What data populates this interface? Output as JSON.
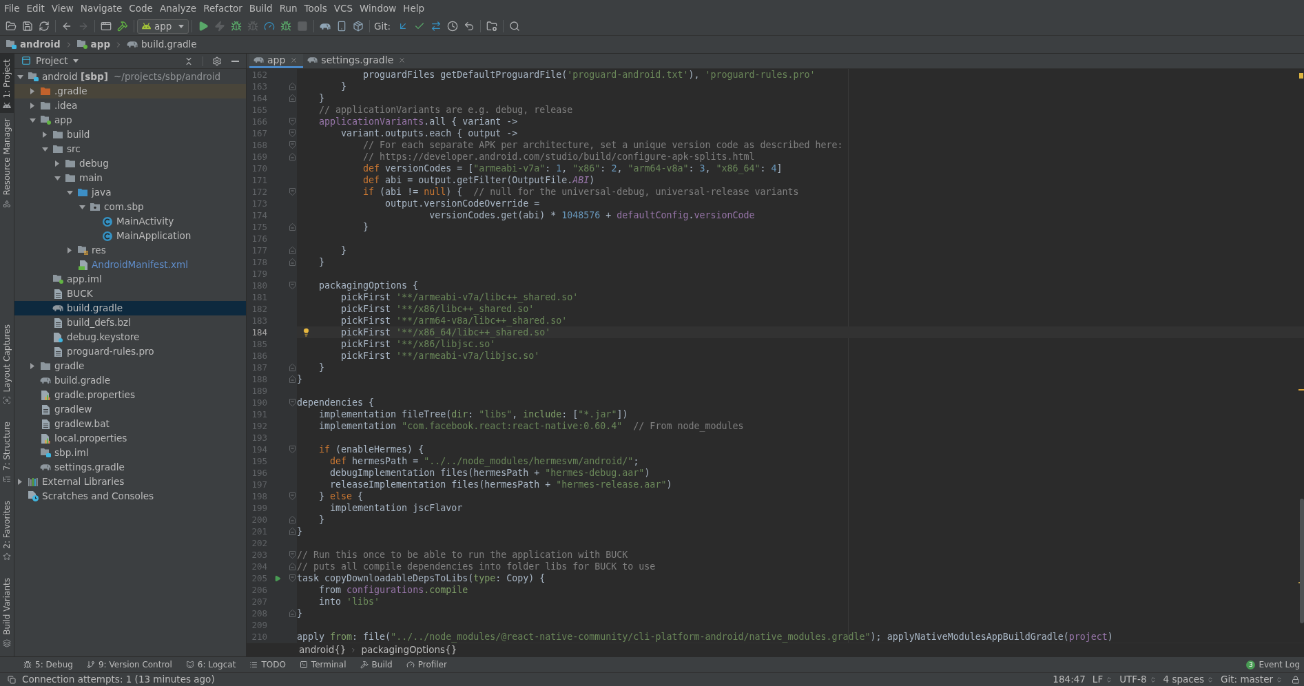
{
  "menu": [
    "File",
    "Edit",
    "View",
    "Navigate",
    "Code",
    "Analyze",
    "Refactor",
    "Build",
    "Run",
    "Tools",
    "VCS",
    "Window",
    "Help"
  ],
  "toolbar": {
    "groups": [
      {
        "buttons": [
          {
            "kind": "open",
            "disabled": false
          },
          {
            "kind": "save",
            "disabled": false
          },
          {
            "kind": "sync",
            "disabled": false
          }
        ]
      },
      {
        "buttons": [
          {
            "kind": "back",
            "disabled": false
          },
          {
            "kind": "forward",
            "disabled": true
          }
        ]
      },
      {
        "buttons": [
          {
            "kind": "window",
            "disabled": false
          },
          {
            "kind": "make",
            "disabled": false
          }
        ]
      },
      {
        "run_config": "app"
      },
      {
        "buttons": [
          {
            "kind": "run",
            "disabled": false
          },
          {
            "kind": "apply",
            "disabled": true
          },
          {
            "kind": "debug",
            "disabled": false
          },
          {
            "kind": "attach",
            "disabled": true
          },
          {
            "kind": "profile",
            "disabled": false
          },
          {
            "kind": "apply_code",
            "disabled": false
          },
          {
            "kind": "stop",
            "disabled": true
          }
        ]
      },
      {
        "buttons": [
          {
            "kind": "gradle",
            "disabled": false
          },
          {
            "kind": "device",
            "disabled": false
          },
          {
            "kind": "sdk",
            "disabled": false
          }
        ]
      },
      {
        "label": "Git:",
        "buttons": [
          {
            "kind": "update",
            "disabled": false
          },
          {
            "kind": "commit",
            "disabled": false
          },
          {
            "kind": "compare",
            "disabled": false
          },
          {
            "kind": "history",
            "disabled": false
          },
          {
            "kind": "rollback",
            "disabled": false
          }
        ]
      },
      {
        "buttons": [
          {
            "kind": "structure",
            "disabled": false
          }
        ]
      },
      {
        "buttons": [
          {
            "kind": "search",
            "disabled": false
          }
        ]
      }
    ]
  },
  "nav_bar": [
    {
      "kind": "module",
      "label": "android"
    },
    {
      "kind": "android_module",
      "label": "app"
    },
    {
      "kind": "gradle",
      "label": "build.gradle"
    }
  ],
  "tool_strip": {
    "top": [
      {
        "kind": "project",
        "label": "1: Project",
        "selected": true
      },
      {
        "kind": "resources",
        "label": "Resource Manager",
        "selected": false
      }
    ],
    "bottom": [
      {
        "kind": "captures",
        "label": "Layout Captures",
        "selected": false
      },
      {
        "kind": "structure",
        "label": "7: Structure",
        "selected": false
      },
      {
        "kind": "favorites",
        "label": "2: Favorites",
        "selected": false
      },
      {
        "kind": "variants",
        "label": "Build Variants",
        "selected": false
      }
    ]
  },
  "project_panel": {
    "title": "Project",
    "tree": [
      {
        "kind": "module",
        "label": "android **[sbp]**",
        "path": "~/projects/sbp/android",
        "expanded": true,
        "selected": false,
        "children": [
          {
            "kind": "excluded_folder",
            "label": ".gradle",
            "expanded": false,
            "selected": false
          },
          {
            "kind": "folder",
            "label": ".idea",
            "expanded": false,
            "selected": false
          },
          {
            "kind": "android_module",
            "label": "app",
            "expanded": true,
            "selected": false,
            "children": [
              {
                "kind": "folder",
                "label": "build",
                "expanded": false,
                "selected": false
              },
              {
                "kind": "folder",
                "label": "src",
                "expanded": true,
                "selected": false,
                "children": [
                  {
                    "kind": "folder",
                    "label": "debug",
                    "expanded": false,
                    "selected": false
                  },
                  {
                    "kind": "folder",
                    "label": "main",
                    "expanded": true,
                    "selected": false,
                    "children": [
                      {
                        "kind": "source_folder",
                        "label": "java",
                        "expanded": true,
                        "selected": false,
                        "children": [
                          {
                            "kind": "package",
                            "label": "com.sbp",
                            "expanded": true,
                            "selected": false,
                            "children": [
                              {
                                "kind": "class",
                                "label": "MainActivity",
                                "selected": false
                              },
                              {
                                "kind": "class",
                                "label": "MainApplication",
                                "selected": false
                              }
                            ]
                          }
                        ]
                      },
                      {
                        "kind": "resource_folder",
                        "label": "res",
                        "expanded": false,
                        "selected": false
                      },
                      {
                        "kind": "manifest",
                        "label": "AndroidManifest.xml",
                        "selected": false,
                        "modified": true
                      }
                    ]
                  }
                ]
              },
              {
                "kind": "android_module_file",
                "label": "app.iml",
                "selected": false
              },
              {
                "kind": "text_file",
                "label": "BUCK",
                "selected": false
              },
              {
                "kind": "gradle",
                "label": "build.gradle",
                "selected": true
              },
              {
                "kind": "text_file",
                "label": "build_defs.bzl",
                "selected": false
              },
              {
                "kind": "unknown_file",
                "label": "debug.keystore",
                "selected": false
              },
              {
                "kind": "text_file",
                "label": "proguard-rules.pro",
                "selected": false
              }
            ]
          },
          {
            "kind": "folder",
            "label": "gradle",
            "expanded": false,
            "selected": false
          },
          {
            "kind": "gradle",
            "label": "build.gradle",
            "selected": false
          },
          {
            "kind": "properties",
            "label": "gradle.properties",
            "selected": false
          },
          {
            "kind": "text_file",
            "label": "gradlew",
            "selected": false
          },
          {
            "kind": "text_file",
            "label": "gradlew.bat",
            "selected": false
          },
          {
            "kind": "properties",
            "label": "local.properties",
            "selected": false
          },
          {
            "kind": "module_file",
            "label": "sbp.iml",
            "selected": false
          },
          {
            "kind": "gradle",
            "label": "settings.gradle",
            "selected": false
          }
        ]
      },
      {
        "kind": "libraries",
        "label": "External Libraries",
        "expanded": false,
        "selected": false
      },
      {
        "kind": "scratches",
        "label": "Scratches and Consoles",
        "selected": false
      }
    ]
  },
  "editor": {
    "tabs": [
      {
        "label": "app",
        "selected": true
      },
      {
        "label": "settings.gradle",
        "selected": false
      }
    ],
    "lines": [
      {
        "number": "162",
        "current": false,
        "tokens": [
          {
            "kind": "plain",
            "text": "            proguardFiles getDefaultProguardFile("
          },
          {
            "kind": "string",
            "text": "'proguard-android.txt'"
          },
          {
            "kind": "plain",
            "text": "), "
          },
          {
            "kind": "string",
            "text": "'proguard-rules.pro'"
          }
        ]
      },
      {
        "number": "163",
        "current": false,
        "fold_end": true,
        "tokens": [
          {
            "kind": "plain",
            "text": "        }"
          }
        ]
      },
      {
        "number": "164",
        "current": false,
        "fold_end": true,
        "tokens": [
          {
            "kind": "plain",
            "text": "    }"
          }
        ]
      },
      {
        "number": "165",
        "current": false,
        "tokens": [
          {
            "kind": "comment",
            "text": "    // applicationVariants are e.g. debug, release"
          }
        ]
      },
      {
        "number": "166",
        "current": false,
        "fold_start": true,
        "tokens": [
          {
            "kind": "field",
            "text": "    applicationVariants"
          },
          {
            "kind": "plain",
            "text": ".all { variant ->"
          }
        ]
      },
      {
        "number": "167",
        "current": false,
        "fold_start": true,
        "tokens": [
          {
            "kind": "plain",
            "text": "        variant.outputs.each { output ->"
          }
        ]
      },
      {
        "number": "168",
        "current": false,
        "fold_start": true,
        "tokens": [
          {
            "kind": "comment",
            "text": "            // For each separate APK per architecture, set a unique version code as described here:"
          }
        ]
      },
      {
        "number": "169",
        "current": false,
        "fold_end": true,
        "tokens": [
          {
            "kind": "comment",
            "text": "            // https://developer.android.com/studio/build/configure-apk-splits.html"
          }
        ]
      },
      {
        "number": "170",
        "current": false,
        "tokens": [
          {
            "kind": "keyword",
            "text": "            def"
          },
          {
            "kind": "plain",
            "text": " versionCodes = ["
          },
          {
            "kind": "string",
            "text": "\"armeabi-v7a\""
          },
          {
            "kind": "plain",
            "text": ": "
          },
          {
            "kind": "number",
            "text": "1"
          },
          {
            "kind": "plain",
            "text": ", "
          },
          {
            "kind": "string",
            "text": "\"x86\""
          },
          {
            "kind": "plain",
            "text": ": "
          },
          {
            "kind": "number",
            "text": "2"
          },
          {
            "kind": "plain",
            "text": ", "
          },
          {
            "kind": "string",
            "text": "\"arm64-v8a\""
          },
          {
            "kind": "plain",
            "text": ": "
          },
          {
            "kind": "number",
            "text": "3"
          },
          {
            "kind": "plain",
            "text": ", "
          },
          {
            "kind": "string",
            "text": "\"x86_64\""
          },
          {
            "kind": "plain",
            "text": ": "
          },
          {
            "kind": "number",
            "text": "4"
          },
          {
            "kind": "plain",
            "text": "]"
          }
        ]
      },
      {
        "number": "171",
        "current": false,
        "tokens": [
          {
            "kind": "keyword",
            "text": "            def"
          },
          {
            "kind": "plain",
            "text": " abi = output.getFilter(OutputFile."
          },
          {
            "kind": "constant",
            "text": "ABI"
          },
          {
            "kind": "plain",
            "text": ")"
          }
        ]
      },
      {
        "number": "172",
        "current": false,
        "fold_start": true,
        "tokens": [
          {
            "kind": "keyword",
            "text": "            if"
          },
          {
            "kind": "plain",
            "text": " (abi != "
          },
          {
            "kind": "keyword",
            "text": "null"
          },
          {
            "kind": "plain",
            "text": ") {  "
          },
          {
            "kind": "comment",
            "text": "// null for the universal-debug, universal-release variants"
          }
        ]
      },
      {
        "number": "173",
        "current": false,
        "tokens": [
          {
            "kind": "plain",
            "text": "                output.versionCodeOverride ="
          }
        ]
      },
      {
        "number": "174",
        "current": false,
        "tokens": [
          {
            "kind": "plain",
            "text": "                        versionCodes.get(abi) * "
          },
          {
            "kind": "number",
            "text": "1048576"
          },
          {
            "kind": "plain",
            "text": " + "
          },
          {
            "kind": "field",
            "text": "defaultConfig"
          },
          {
            "kind": "plain",
            "text": "."
          },
          {
            "kind": "field",
            "text": "versionCode"
          }
        ]
      },
      {
        "number": "175",
        "current": false,
        "fold_end": true,
        "tokens": [
          {
            "kind": "plain",
            "text": "            }"
          }
        ]
      },
      {
        "number": "176",
        "current": false
      },
      {
        "number": "177",
        "current": false,
        "fold_end": true,
        "tokens": [
          {
            "kind": "plain",
            "text": "        }"
          }
        ]
      },
      {
        "number": "178",
        "current": false,
        "fold_end": true,
        "tokens": [
          {
            "kind": "plain",
            "text": "    }"
          }
        ]
      },
      {
        "number": "179",
        "current": false
      },
      {
        "number": "180",
        "current": false,
        "fold_start": true,
        "tokens": [
          {
            "kind": "plain",
            "text": "    packagingOptions {"
          }
        ]
      },
      {
        "number": "181",
        "current": false,
        "tokens": [
          {
            "kind": "plain",
            "text": "        pickFirst "
          },
          {
            "kind": "string",
            "text": "'**/armeabi-v7a/libc++_shared.so'"
          }
        ]
      },
      {
        "number": "182",
        "current": false,
        "tokens": [
          {
            "kind": "plain",
            "text": "        pickFirst "
          },
          {
            "kind": "string",
            "text": "'**/x86/libc++_shared.so'"
          }
        ]
      },
      {
        "number": "183",
        "current": false,
        "tokens": [
          {
            "kind": "plain",
            "text": "        pickFirst "
          },
          {
            "kind": "string",
            "text": "'**/arm64-v8a/libc++_shared.so'"
          }
        ]
      },
      {
        "number": "184",
        "current": true,
        "intention": true,
        "tokens": [
          {
            "kind": "plain",
            "text": "        pickFirst "
          },
          {
            "kind": "string",
            "text": "'**/x86_64/libc++_shared.so'"
          }
        ]
      },
      {
        "number": "185",
        "current": false,
        "tokens": [
          {
            "kind": "plain",
            "text": "        pickFirst "
          },
          {
            "kind": "string",
            "text": "'**/x86/libjsc.so'"
          }
        ]
      },
      {
        "number": "186",
        "current": false,
        "tokens": [
          {
            "kind": "plain",
            "text": "        pickFirst "
          },
          {
            "kind": "string",
            "text": "'**/armeabi-v7a/libjsc.so'"
          }
        ]
      },
      {
        "number": "187",
        "current": false,
        "fold_end": true,
        "tokens": [
          {
            "kind": "plain",
            "text": "    }"
          }
        ]
      },
      {
        "number": "188",
        "current": false,
        "fold_end": true,
        "tokens": [
          {
            "kind": "plain",
            "text": "}"
          }
        ]
      },
      {
        "number": "189",
        "current": false
      },
      {
        "number": "190",
        "current": false,
        "fold_start": true,
        "tokens": [
          {
            "kind": "plain",
            "text": "dependencies {"
          }
        ]
      },
      {
        "number": "191",
        "current": false,
        "tokens": [
          {
            "kind": "plain",
            "text": "    implementation fileTree("
          },
          {
            "kind": "label",
            "text": "dir"
          },
          {
            "kind": "plain",
            "text": ": "
          },
          {
            "kind": "string",
            "text": "\"libs\""
          },
          {
            "kind": "plain",
            "text": ", "
          },
          {
            "kind": "label",
            "text": "include"
          },
          {
            "kind": "plain",
            "text": ": ["
          },
          {
            "kind": "string",
            "text": "\"*.jar\""
          },
          {
            "kind": "plain",
            "text": "])"
          }
        ]
      },
      {
        "number": "192",
        "current": false,
        "tokens": [
          {
            "kind": "plain",
            "text": "    implementation "
          },
          {
            "kind": "string",
            "text": "\"com.facebook.react:react-native:0.60.4\""
          },
          {
            "kind": "comment",
            "text": "  // From node_modules"
          }
        ]
      },
      {
        "number": "193",
        "current": false
      },
      {
        "number": "194",
        "current": false,
        "fold_start": true,
        "tokens": [
          {
            "kind": "keyword",
            "text": "    if"
          },
          {
            "kind": "plain",
            "text": " (enableHermes) {"
          }
        ]
      },
      {
        "number": "195",
        "current": false,
        "tokens": [
          {
            "kind": "keyword",
            "text": "      def"
          },
          {
            "kind": "plain",
            "text": " hermesPath = "
          },
          {
            "kind": "string",
            "text": "\"../../node_modules/hermesvm/android/\""
          },
          {
            "kind": "plain",
            "text": ";"
          }
        ]
      },
      {
        "number": "196",
        "current": false,
        "tokens": [
          {
            "kind": "plain",
            "text": "      debugImplementation files(hermesPath + "
          },
          {
            "kind": "string",
            "text": "\"hermes-debug.aar\""
          },
          {
            "kind": "plain",
            "text": ")"
          }
        ]
      },
      {
        "number": "197",
        "current": false,
        "tokens": [
          {
            "kind": "plain",
            "text": "      releaseImplementation files(hermesPath + "
          },
          {
            "kind": "string",
            "text": "\"hermes-release.aar\""
          },
          {
            "kind": "plain",
            "text": ")"
          }
        ]
      },
      {
        "number": "198",
        "current": false,
        "fold_start": true,
        "tokens": [
          {
            "kind": "plain",
            "text": "    } "
          },
          {
            "kind": "keyword",
            "text": "else"
          },
          {
            "kind": "plain",
            "text": " {"
          }
        ]
      },
      {
        "number": "199",
        "current": false,
        "tokens": [
          {
            "kind": "plain",
            "text": "      implementation jscFlavor"
          }
        ]
      },
      {
        "number": "200",
        "current": false,
        "fold_end": true,
        "tokens": [
          {
            "kind": "plain",
            "text": "    }"
          }
        ]
      },
      {
        "number": "201",
        "current": false,
        "fold_end": true,
        "tokens": [
          {
            "kind": "plain",
            "text": "}"
          }
        ]
      },
      {
        "number": "202",
        "current": false
      },
      {
        "number": "203",
        "current": false,
        "fold_start": true,
        "tokens": [
          {
            "kind": "comment",
            "text": "// Run this once to be able to run the application with BUCK"
          }
        ]
      },
      {
        "number": "204",
        "current": false,
        "fold_end": true,
        "tokens": [
          {
            "kind": "comment",
            "text": "// puts all compile dependencies into folder libs for BUCK to use"
          }
        ]
      },
      {
        "number": "205",
        "current": false,
        "fold_start": true,
        "runnable": true,
        "tokens": [
          {
            "kind": "plain",
            "text": "task copyDownloadableDepsToLibs("
          },
          {
            "kind": "label",
            "text": "type"
          },
          {
            "kind": "plain",
            "text": ": Copy) {"
          }
        ]
      },
      {
        "number": "206",
        "current": false,
        "tokens": [
          {
            "kind": "plain",
            "text": "    from "
          },
          {
            "kind": "field",
            "text": "configurations"
          },
          {
            "kind": "label",
            "text": ".compile"
          }
        ]
      },
      {
        "number": "207",
        "current": false,
        "tokens": [
          {
            "kind": "plain",
            "text": "    into "
          },
          {
            "kind": "string",
            "text": "'libs'"
          }
        ]
      },
      {
        "number": "208",
        "current": false,
        "fold_end": true,
        "tokens": [
          {
            "kind": "plain",
            "text": "}"
          }
        ]
      },
      {
        "number": "209",
        "current": false
      },
      {
        "number": "210",
        "current": false,
        "tokens": [
          {
            "kind": "plain",
            "text": "apply "
          },
          {
            "kind": "label",
            "text": "from"
          },
          {
            "kind": "plain",
            "text": ": file("
          },
          {
            "kind": "string",
            "text": "\"../../node_modules/@react-native-community/cli-platform-android/native_modules.gradle\""
          },
          {
            "kind": "plain",
            "text": "); applyNativeModulesAppBuildGradle("
          },
          {
            "kind": "field",
            "text": "project"
          },
          {
            "kind": "plain",
            "text": ")"
          }
        ]
      }
    ],
    "breadcrumbs": [
      "android{}",
      "packagingOptions{}"
    ]
  },
  "bottom_bar": {
    "tool_windows": [
      {
        "kind": "debug",
        "label": "5: Debug"
      },
      {
        "kind": "vcs",
        "label": "9: Version Control"
      },
      {
        "kind": "logcat",
        "label": "6: Logcat"
      },
      {
        "kind": "todo",
        "label": "TODO"
      },
      {
        "kind": "terminal",
        "label": "Terminal"
      },
      {
        "kind": "build",
        "label": "Build"
      },
      {
        "kind": "profiler",
        "label": "Profiler"
      }
    ],
    "event_log": {
      "label": "Event Log",
      "count": "3"
    }
  },
  "status_bar": {
    "message": "Connection attempts: 1 (13 minutes ago)",
    "widgets": [
      {
        "label": "184:47",
        "dropdown": false
      },
      {
        "label": "LF",
        "dropdown": true
      },
      {
        "label": "UTF-8",
        "dropdown": true
      },
      {
        "label": "4 spaces",
        "dropdown": true
      },
      {
        "label": "Git: master",
        "dropdown": true
      }
    ]
  }
}
